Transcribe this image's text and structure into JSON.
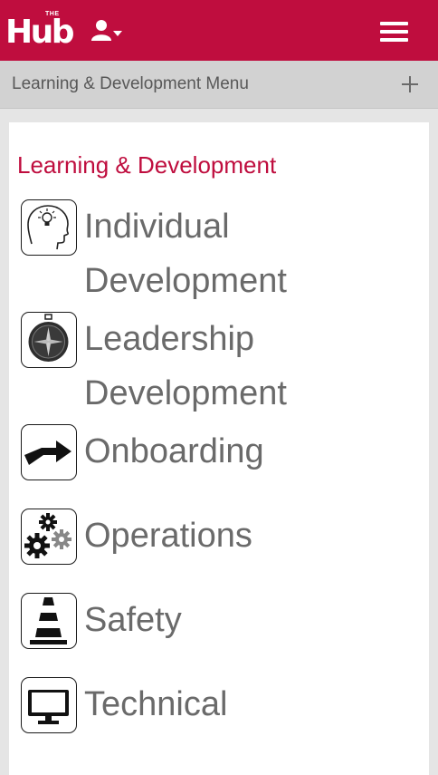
{
  "header": {
    "logo_small": "THE",
    "logo_word": "Hub",
    "user_icon": "user-icon",
    "dropdown_icon": "caret-down-icon",
    "menu_icon": "hamburger-icon"
  },
  "menu_bar": {
    "label": "Learning & Development Menu",
    "expand_icon": "plus-icon"
  },
  "section": {
    "title": "Learning & Development",
    "items": [
      {
        "label": "Individual Development",
        "icon": "head-lightbulb-icon"
      },
      {
        "label": "Leadership Development",
        "icon": "compass-icon"
      },
      {
        "label": "Onboarding",
        "icon": "arrow-right-icon"
      },
      {
        "label": "Operations",
        "icon": "gears-icon"
      },
      {
        "label": "Safety",
        "icon": "traffic-cone-icon"
      },
      {
        "label": "Technical",
        "icon": "monitor-icon"
      }
    ]
  },
  "colors": {
    "brand": "#bf0d3e",
    "menu_bar_bg": "#d2d2d2",
    "page_bg": "#e5e5e5",
    "item_text": "#6a6a6a"
  }
}
